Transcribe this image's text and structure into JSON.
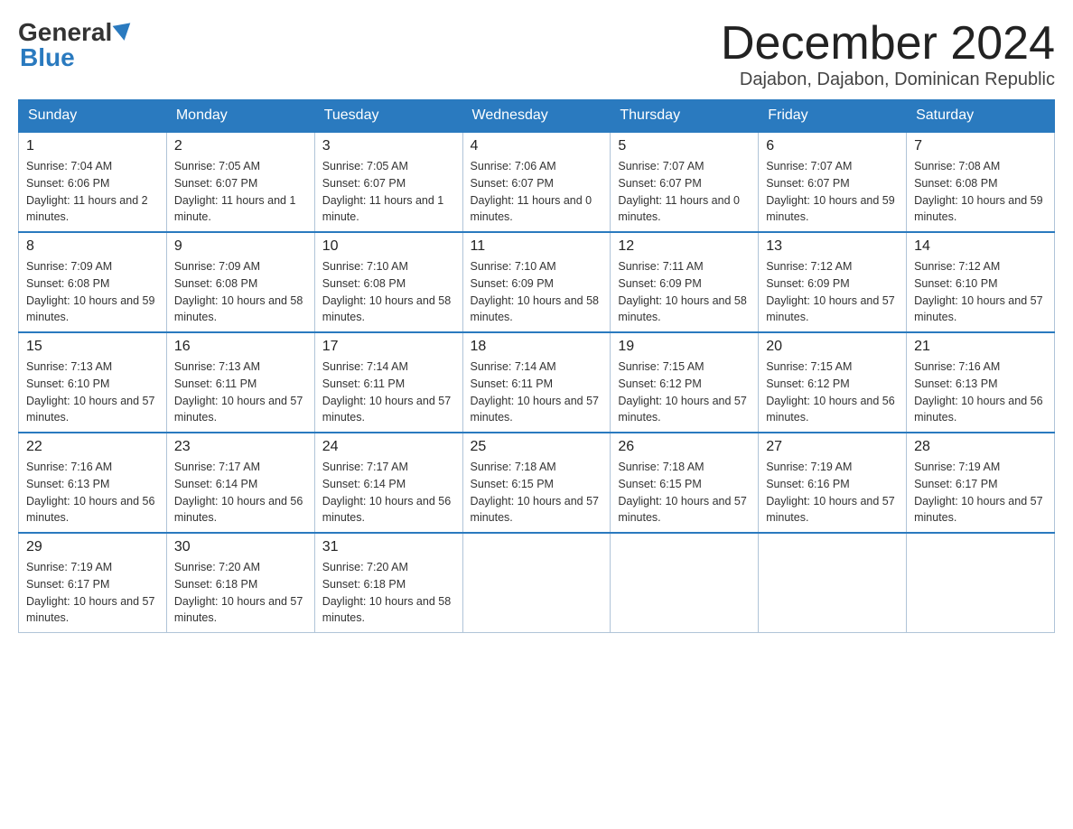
{
  "logo": {
    "general": "General",
    "blue": "Blue"
  },
  "header": {
    "month": "December 2024",
    "location": "Dajabon, Dajabon, Dominican Republic"
  },
  "weekdays": [
    "Sunday",
    "Monday",
    "Tuesday",
    "Wednesday",
    "Thursday",
    "Friday",
    "Saturday"
  ],
  "weeks": [
    [
      {
        "day": "1",
        "sunrise": "7:04 AM",
        "sunset": "6:06 PM",
        "daylight": "11 hours and 2 minutes."
      },
      {
        "day": "2",
        "sunrise": "7:05 AM",
        "sunset": "6:07 PM",
        "daylight": "11 hours and 1 minute."
      },
      {
        "day": "3",
        "sunrise": "7:05 AM",
        "sunset": "6:07 PM",
        "daylight": "11 hours and 1 minute."
      },
      {
        "day": "4",
        "sunrise": "7:06 AM",
        "sunset": "6:07 PM",
        "daylight": "11 hours and 0 minutes."
      },
      {
        "day": "5",
        "sunrise": "7:07 AM",
        "sunset": "6:07 PM",
        "daylight": "11 hours and 0 minutes."
      },
      {
        "day": "6",
        "sunrise": "7:07 AM",
        "sunset": "6:07 PM",
        "daylight": "10 hours and 59 minutes."
      },
      {
        "day": "7",
        "sunrise": "7:08 AM",
        "sunset": "6:08 PM",
        "daylight": "10 hours and 59 minutes."
      }
    ],
    [
      {
        "day": "8",
        "sunrise": "7:09 AM",
        "sunset": "6:08 PM",
        "daylight": "10 hours and 59 minutes."
      },
      {
        "day": "9",
        "sunrise": "7:09 AM",
        "sunset": "6:08 PM",
        "daylight": "10 hours and 58 minutes."
      },
      {
        "day": "10",
        "sunrise": "7:10 AM",
        "sunset": "6:08 PM",
        "daylight": "10 hours and 58 minutes."
      },
      {
        "day": "11",
        "sunrise": "7:10 AM",
        "sunset": "6:09 PM",
        "daylight": "10 hours and 58 minutes."
      },
      {
        "day": "12",
        "sunrise": "7:11 AM",
        "sunset": "6:09 PM",
        "daylight": "10 hours and 58 minutes."
      },
      {
        "day": "13",
        "sunrise": "7:12 AM",
        "sunset": "6:09 PM",
        "daylight": "10 hours and 57 minutes."
      },
      {
        "day": "14",
        "sunrise": "7:12 AM",
        "sunset": "6:10 PM",
        "daylight": "10 hours and 57 minutes."
      }
    ],
    [
      {
        "day": "15",
        "sunrise": "7:13 AM",
        "sunset": "6:10 PM",
        "daylight": "10 hours and 57 minutes."
      },
      {
        "day": "16",
        "sunrise": "7:13 AM",
        "sunset": "6:11 PM",
        "daylight": "10 hours and 57 minutes."
      },
      {
        "day": "17",
        "sunrise": "7:14 AM",
        "sunset": "6:11 PM",
        "daylight": "10 hours and 57 minutes."
      },
      {
        "day": "18",
        "sunrise": "7:14 AM",
        "sunset": "6:11 PM",
        "daylight": "10 hours and 57 minutes."
      },
      {
        "day": "19",
        "sunrise": "7:15 AM",
        "sunset": "6:12 PM",
        "daylight": "10 hours and 57 minutes."
      },
      {
        "day": "20",
        "sunrise": "7:15 AM",
        "sunset": "6:12 PM",
        "daylight": "10 hours and 56 minutes."
      },
      {
        "day": "21",
        "sunrise": "7:16 AM",
        "sunset": "6:13 PM",
        "daylight": "10 hours and 56 minutes."
      }
    ],
    [
      {
        "day": "22",
        "sunrise": "7:16 AM",
        "sunset": "6:13 PM",
        "daylight": "10 hours and 56 minutes."
      },
      {
        "day": "23",
        "sunrise": "7:17 AM",
        "sunset": "6:14 PM",
        "daylight": "10 hours and 56 minutes."
      },
      {
        "day": "24",
        "sunrise": "7:17 AM",
        "sunset": "6:14 PM",
        "daylight": "10 hours and 56 minutes."
      },
      {
        "day": "25",
        "sunrise": "7:18 AM",
        "sunset": "6:15 PM",
        "daylight": "10 hours and 57 minutes."
      },
      {
        "day": "26",
        "sunrise": "7:18 AM",
        "sunset": "6:15 PM",
        "daylight": "10 hours and 57 minutes."
      },
      {
        "day": "27",
        "sunrise": "7:19 AM",
        "sunset": "6:16 PM",
        "daylight": "10 hours and 57 minutes."
      },
      {
        "day": "28",
        "sunrise": "7:19 AM",
        "sunset": "6:17 PM",
        "daylight": "10 hours and 57 minutes."
      }
    ],
    [
      {
        "day": "29",
        "sunrise": "7:19 AM",
        "sunset": "6:17 PM",
        "daylight": "10 hours and 57 minutes."
      },
      {
        "day": "30",
        "sunrise": "7:20 AM",
        "sunset": "6:18 PM",
        "daylight": "10 hours and 57 minutes."
      },
      {
        "day": "31",
        "sunrise": "7:20 AM",
        "sunset": "6:18 PM",
        "daylight": "10 hours and 58 minutes."
      },
      null,
      null,
      null,
      null
    ]
  ]
}
